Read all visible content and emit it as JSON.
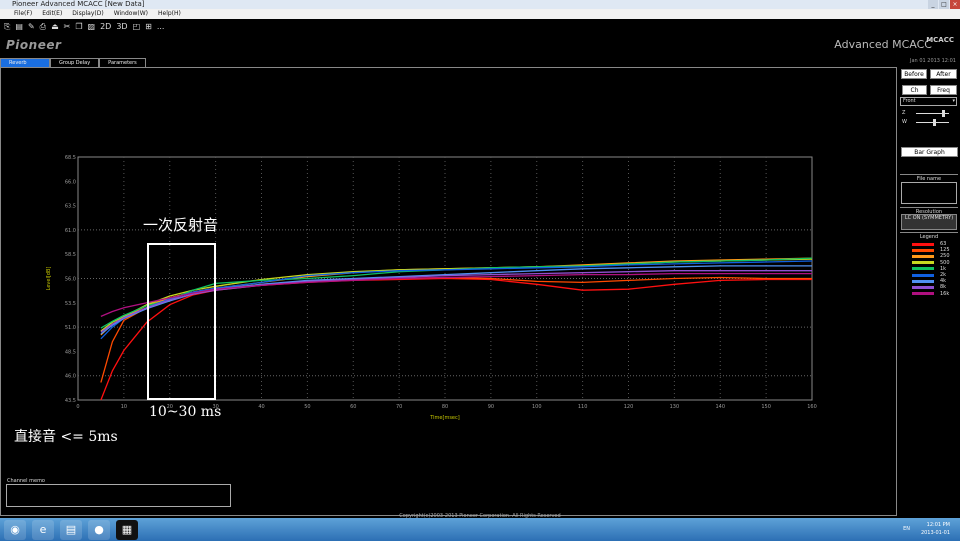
{
  "window": {
    "title": "Pioneer Advanced MCACC [New Data]",
    "menu": [
      "File(F)",
      "Edit(E)",
      "Display(D)",
      "Window(W)",
      "Help(H)"
    ],
    "toolbar": [
      "open-icon",
      "save-icon",
      "edit-icon",
      "print-icon",
      "export-icon",
      "cut-icon",
      "copy-icon",
      "paste-icon",
      "2D",
      "3D",
      "window-icon",
      "grid-icon",
      "..."
    ]
  },
  "logo": "Pioneer",
  "brand": "Advanced MCACC",
  "date": "Jan 01 2013 12:01",
  "tabs": [
    {
      "label": "Reverb",
      "active": true
    },
    {
      "label": "Group Delay"
    },
    {
      "label": "Parameters"
    }
  ],
  "side": {
    "before": "Before",
    "after": "After",
    "ch": "Ch",
    "freq": "Freq",
    "channel_select": "Front",
    "z_label": "Z",
    "w_label": "W",
    "z_value": 0.8,
    "w_value": 0.5,
    "bar_graph": "Bar Graph",
    "file_name_label": "File name",
    "resolution_label": "Resolution",
    "resolution_value": "LC ON (SYMMETRY)",
    "legend_label": "Legend"
  },
  "channel_memo_label": "Channel memo",
  "annotations": {
    "early": "一次反射音",
    "range": "10~30 ms",
    "direct": "直接音 <= 5ms"
  },
  "copyright": "Copyright(c)2003-2013 Pioneer Corporation. All Rights Reserved",
  "taskbar": {
    "lang": "EN",
    "time": "12:01 PM",
    "date": "2013-01-01"
  },
  "chart_data": {
    "type": "line",
    "xlabel": "Time[msec]",
    "ylabel": "Level[dB]",
    "xlim": [
      0,
      160
    ],
    "ylim": [
      43.5,
      68.5
    ],
    "xticks": [
      0,
      10,
      20,
      30,
      40,
      50,
      60,
      70,
      80,
      90,
      100,
      110,
      120,
      130,
      140,
      150,
      160
    ],
    "yticks": [
      "68.5",
      "66.0",
      "63.5",
      "61.0",
      "58.5",
      "56.0",
      "53.5",
      "51.0",
      "48.5",
      "46.0",
      "43.5"
    ],
    "grid": true,
    "legend_position": "right-panel",
    "x": [
      5,
      7.5,
      10,
      15,
      20,
      25,
      30,
      40,
      50,
      60,
      70,
      80,
      90,
      100,
      110,
      120,
      130,
      140,
      150,
      160
    ],
    "series": [
      {
        "name": "63",
        "color": "#ff1010",
        "values": [
          43.5,
          46.5,
          48.6,
          51.5,
          53.3,
          54.3,
          54.8,
          55.3,
          55.6,
          55.8,
          55.9,
          56.0,
          55.9,
          55.4,
          54.8,
          54.9,
          55.4,
          55.8,
          55.9,
          55.9
        ]
      },
      {
        "name": "125",
        "color": "#ff4a00",
        "values": [
          45.3,
          49.5,
          51.7,
          53.0,
          54.0,
          54.6,
          54.9,
          55.4,
          55.7,
          55.9,
          56.0,
          56.1,
          56.0,
          55.7,
          55.6,
          55.8,
          56.0,
          56.1,
          56.0,
          56.0
        ]
      },
      {
        "name": "250",
        "color": "#ff9a1a",
        "values": [
          50.2,
          51.3,
          52.0,
          53.2,
          54.0,
          54.6,
          55.0,
          55.6,
          56.2,
          56.6,
          56.9,
          57.0,
          57.1,
          57.2,
          57.4,
          57.6,
          57.8,
          57.9,
          58.0,
          58.1
        ]
      },
      {
        "name": "500",
        "color": "#c8d820",
        "values": [
          50.6,
          51.5,
          52.1,
          53.3,
          54.2,
          54.8,
          55.2,
          55.9,
          56.4,
          56.7,
          56.9,
          57.0,
          57.1,
          57.2,
          57.3,
          57.5,
          57.7,
          57.8,
          57.9,
          58.0
        ]
      },
      {
        "name": "1k",
        "color": "#10c060",
        "values": [
          50.9,
          51.6,
          52.2,
          53.2,
          53.8,
          54.8,
          55.5,
          55.8,
          56.0,
          56.3,
          56.7,
          56.9,
          57.1,
          57.2,
          57.3,
          57.5,
          57.7,
          57.8,
          57.9,
          58.1
        ]
      },
      {
        "name": "2k",
        "color": "#1060e0",
        "values": [
          49.8,
          51.0,
          51.9,
          53.0,
          53.9,
          54.6,
          55.0,
          55.6,
          56.3,
          56.6,
          56.8,
          56.9,
          57.0,
          57.1,
          57.2,
          57.4,
          57.5,
          57.6,
          57.7,
          57.8
        ]
      },
      {
        "name": "4k",
        "color": "#5090f0",
        "values": [
          50.3,
          51.2,
          51.9,
          52.9,
          53.7,
          54.4,
          54.9,
          55.4,
          55.8,
          56.0,
          56.2,
          56.4,
          56.6,
          56.8,
          57.0,
          57.1,
          57.2,
          57.3,
          57.3,
          57.3
        ]
      },
      {
        "name": "8k",
        "color": "#9050d0",
        "values": [
          50.5,
          51.3,
          52.0,
          53.0,
          53.8,
          54.4,
          54.8,
          55.3,
          55.7,
          55.9,
          56.1,
          56.3,
          56.4,
          56.5,
          56.6,
          56.7,
          56.8,
          56.8,
          56.8,
          56.8
        ]
      },
      {
        "name": "16k",
        "color": "#b01080",
        "values": [
          52.1,
          52.6,
          53.0,
          53.5,
          54.0,
          54.5,
          54.9,
          55.3,
          55.6,
          55.8,
          56.0,
          56.1,
          56.2,
          56.3,
          56.4,
          56.4,
          56.5,
          56.5,
          56.5,
          56.5
        ]
      }
    ]
  }
}
